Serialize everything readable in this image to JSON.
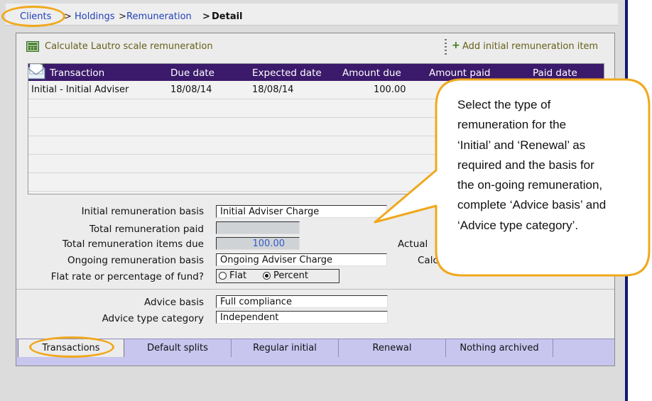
{
  "breadcrumb": {
    "clients": "Clients",
    "sep1": ">",
    "holdings": "Holdings",
    "sep2": ">",
    "remuneration": "Remuneration",
    "sep3": ">",
    "detail": "Detail"
  },
  "toolbar": {
    "calc_icon": "calculator-icon",
    "calc_label": "Calculate Lautro scale remuneration",
    "add_icon": "plus-icon",
    "add_label": "Add initial remuneration item"
  },
  "grid": {
    "icon": "envelope-icon",
    "columns": [
      "Transaction",
      "Due date",
      "Expected date",
      "Amount due",
      "Amount paid",
      "Paid date"
    ],
    "rows": [
      {
        "transaction": "Initial - Initial Adviser",
        "due_date": "18/08/14",
        "expected_date": "18/08/14",
        "amount_due": "100.00"
      }
    ]
  },
  "form": {
    "initial_basis_label": "Initial remuneration basis",
    "initial_basis_value": "Initial Adviser Charge",
    "total_paid_label": "Total remuneration paid",
    "total_paid_value": "",
    "total_items_due_label": "Total remuneration items due",
    "total_items_due_value": "100.00",
    "actual_label": "Actual",
    "ongoing_basis_label": "Ongoing remuneration basis",
    "ongoing_basis_value": "Ongoing Adviser Charge",
    "calc_partial_label": "Calc",
    "flat_or_percent_label": "Flat rate or percentage of fund?",
    "flat_option": "Flat",
    "percent_option": "Percent",
    "selected_option": "Percent",
    "advice_basis_label": "Advice basis",
    "advice_basis_value": "Full compliance",
    "advice_type_label": "Advice type category",
    "advice_type_value": "Independent"
  },
  "tabs": [
    "Transactions",
    "Default splits",
    "Regular initial",
    "Renewal",
    "Nothing archived"
  ],
  "active_tab": "Transactions",
  "callout": {
    "lines": [
      "Select the type of",
      "remuneration for the",
      "‘Initial’ and ‘Renewal’ as",
      "required and the basis for",
      "the on-going remuneration,",
      "complete ‘Advice basis’ and",
      "‘Advice type category’."
    ]
  },
  "colors": {
    "grid_header": "#3b1a6b",
    "tab_bar": "#c8c6ef",
    "highlight": "#f0a81c",
    "link": "#2240b8",
    "toolbar_link": "#66601a"
  }
}
